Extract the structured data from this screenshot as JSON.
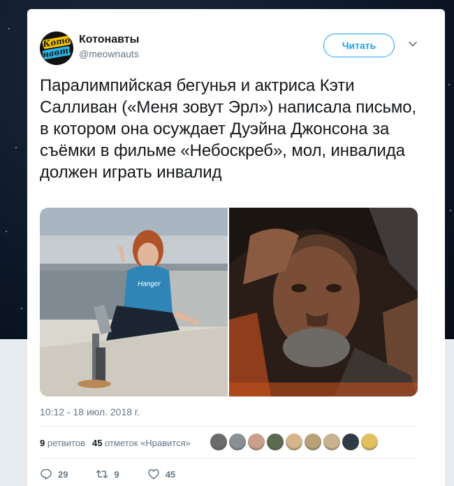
{
  "account": {
    "avatar_text_top": "Кото",
    "avatar_text_bottom": "навты",
    "name": "Котонавты",
    "handle": "@meownauts"
  },
  "follow_button": "Читать",
  "tweet": {
    "text": "Паралимпийская бегунья и актриса Кэти Салливан («Меня зовут Эрл») написала письмо, в котором она осуждает Дуэйна Джонсона за съёмки в фильме «Небоскреб», мол, инвалида должен играть инвалид"
  },
  "media": {
    "left_shirt_text": "Hanger",
    "left_photo_icon": "photo-woman-sitting",
    "right_photo_icon": "photo-man-portrait"
  },
  "timestamp": "10:12 - 18 июл. 2018 г.",
  "stats": {
    "retweets_count": "9",
    "retweets_label": "ретвитов",
    "likes_count": "45",
    "likes_label": "отметок «Нравится»"
  },
  "liker_avatars": [
    "#6b6b6b",
    "#8a8f94",
    "#c9a08a",
    "#5d6a4f",
    "#d8b48c",
    "#b8a27a",
    "#c7b48f",
    "#2f3b45",
    "#e2c060"
  ],
  "actions": {
    "reply_count": "29",
    "retweet_count": "9",
    "like_count": "45"
  },
  "colors": {
    "accent": "#1da1f2",
    "muted": "#657786",
    "text": "#14171a"
  }
}
